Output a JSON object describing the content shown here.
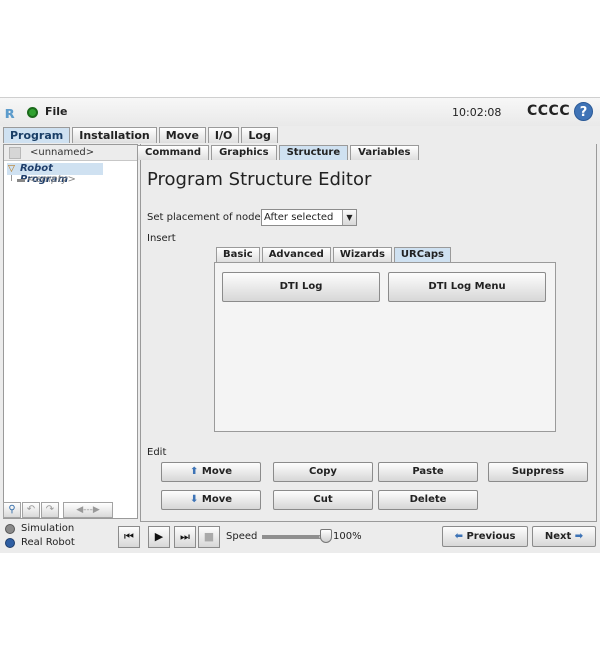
{
  "titlebar": {
    "file_menu": "File",
    "clock": "10:02:08",
    "robot_name": "CCCC",
    "help": "?"
  },
  "main_tabs": [
    {
      "label": "Program",
      "active": true
    },
    {
      "label": "Installation",
      "active": false
    },
    {
      "label": "Move",
      "active": false
    },
    {
      "label": "I/O",
      "active": false
    },
    {
      "label": "Log",
      "active": false
    }
  ],
  "program_tree": {
    "program_name": "<unnamed>",
    "root": "Robot Program",
    "child": "<empty>"
  },
  "left_toolbar": {
    "move_node": "◀---▶"
  },
  "sub_tabs": [
    {
      "label": "Command",
      "active": false
    },
    {
      "label": "Graphics",
      "active": false
    },
    {
      "label": "Structure",
      "active": true
    },
    {
      "label": "Variables",
      "active": false
    }
  ],
  "editor": {
    "title": "Program Structure Editor",
    "placement_label": "Set placement of node",
    "placement_value": "After selected",
    "insert_label": "Insert",
    "insert_tabs": [
      {
        "label": "Basic",
        "active": false
      },
      {
        "label": "Advanced",
        "active": false
      },
      {
        "label": "Wizards",
        "active": false
      },
      {
        "label": "URCaps",
        "active": true
      }
    ],
    "urcaps_buttons": {
      "dti_log": "DTI Log",
      "dti_log_menu": "DTI Log Menu"
    },
    "edit_label": "Edit",
    "edit_buttons": {
      "move_up": "Move",
      "move_down": "Move",
      "copy": "Copy",
      "cut": "Cut",
      "paste": "Paste",
      "delete": "Delete",
      "suppress": "Suppress"
    }
  },
  "bottom_bar": {
    "simulation": "Simulation",
    "real_robot": "Real Robot",
    "speed_label": "Speed",
    "speed_value": "100%",
    "speed_fraction": 1.0,
    "previous": "Previous",
    "next": "Next"
  }
}
